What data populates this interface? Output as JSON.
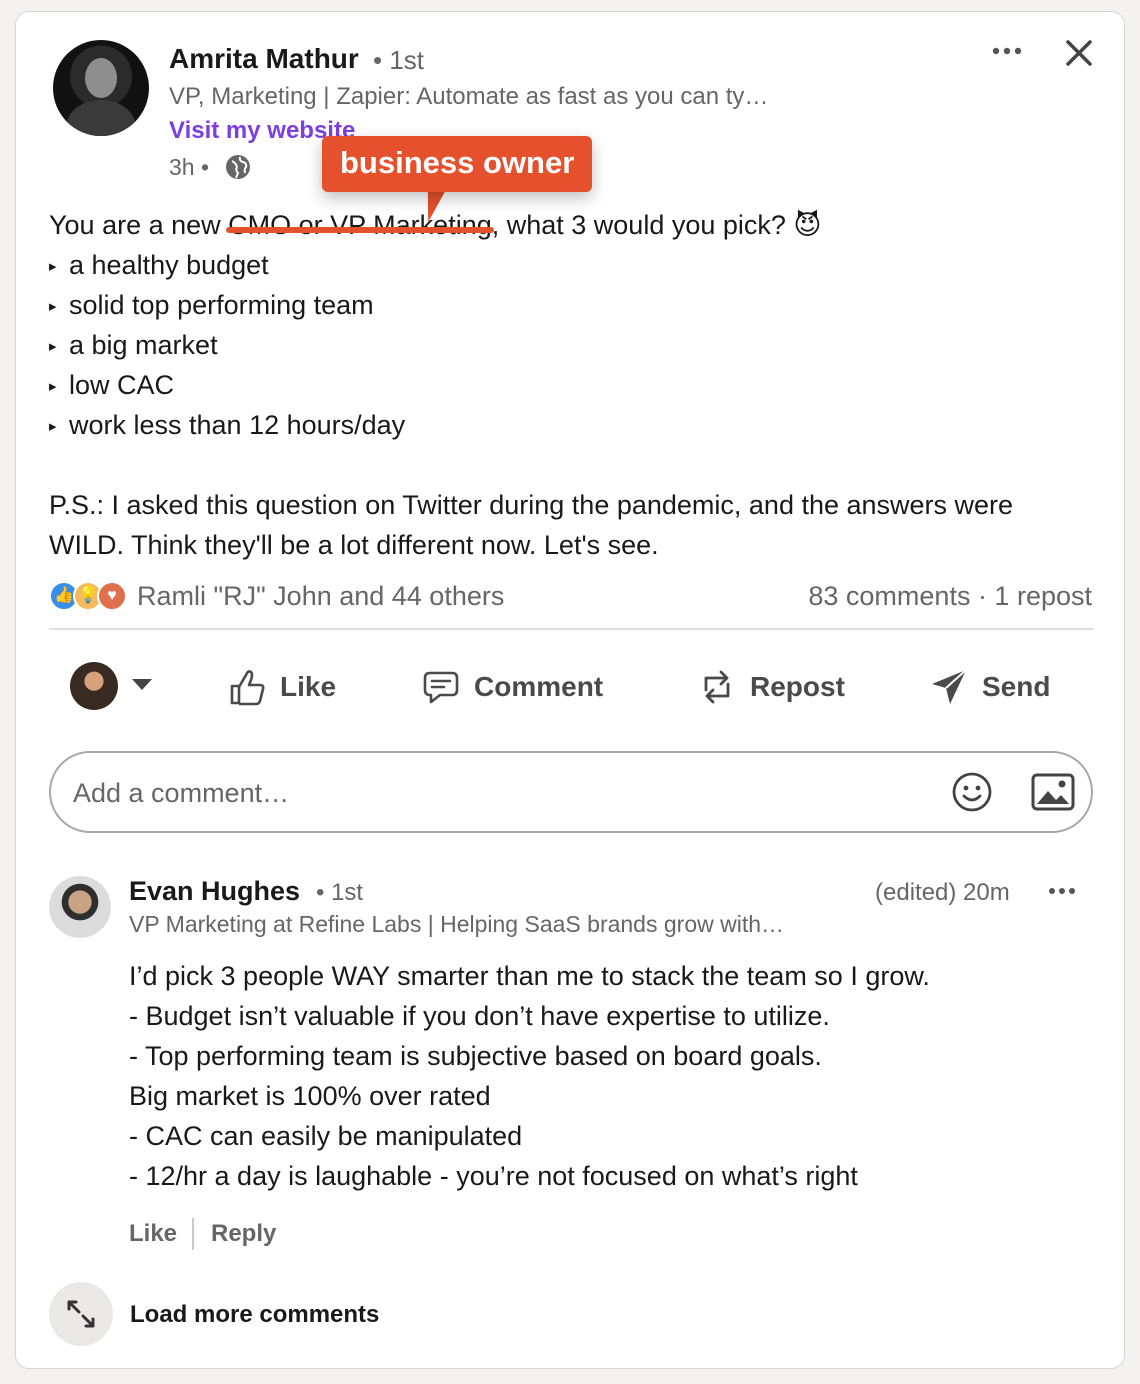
{
  "post": {
    "author_name": "Amrita Mathur",
    "degree": "• 1st",
    "headline": "VP, Marketing | Zapier: Automate as fast as you can ty…",
    "website_link": "Visit my website",
    "time": "3h •",
    "annotation": "business owner",
    "text_intro": "You are a new ",
    "struck_text": "CMO or VP Marketing",
    "text_after": ", what 3 would you pick? 😈",
    "bullets": [
      "a healthy budget",
      "solid top performing team",
      "a big market",
      "low CAC",
      "work less than 12 hours/day"
    ],
    "ps_line1": "P.S.: I asked this question on Twitter during the pandemic, and the answers were",
    "ps_line2": "WILD. Think they'll be a lot different now. Let's see.",
    "reactions_names": "Ramli \"RJ\" John and 44 others",
    "reactions_counts": "83 comments · 1 repost"
  },
  "actions": {
    "like": "Like",
    "comment": "Comment",
    "repost": "Repost",
    "send": "Send"
  },
  "comment_box": {
    "placeholder": "Add a comment…"
  },
  "comment": {
    "name": "Evan Hughes",
    "degree": "• 1st",
    "meta": "(edited) 20m",
    "headline": "VP Marketing at Refine Labs | Helping SaaS brands grow with…",
    "lines": [
      "I’d pick 3 people WAY smarter than me to stack the team so I grow.",
      "- Budget isn’t valuable if you don’t have expertise to utilize.",
      "- Top performing team is subjective based on board goals.",
      "Big market is 100% over rated",
      "- CAC can easily be manipulated",
      "- 12/hr a day is laughable - you’re not focused on what’s right"
    ],
    "like": "Like",
    "reply": "Reply"
  },
  "load_more": "Load more comments",
  "colors": {
    "accent_orange": "#e5512d",
    "link_purple": "#7b3fe4",
    "reaction_like": "#378fe9",
    "reaction_insight": "#f5bb5c",
    "reaction_love": "#df704d"
  },
  "icons": [
    "more-icon",
    "close-icon",
    "globe-icon",
    "like-icon",
    "comment-icon",
    "repost-icon",
    "send-icon",
    "emoji-icon",
    "image-icon",
    "expand-icon"
  ]
}
